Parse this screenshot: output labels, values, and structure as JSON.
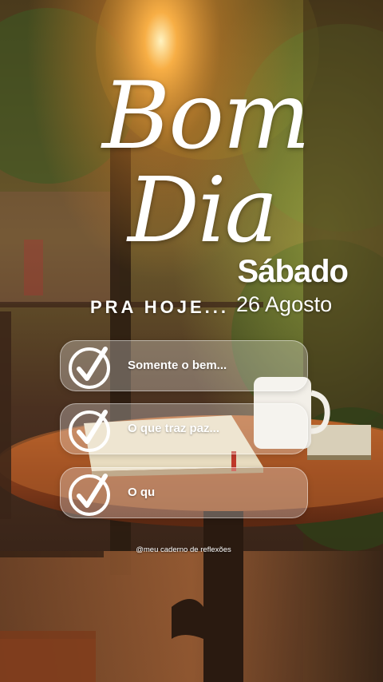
{
  "greeting": {
    "line1": "Bom",
    "line2": "Dia"
  },
  "weekday": "Sábado",
  "pra_hoje": "PRA HOJE...",
  "date": "26 Agosto",
  "items": [
    {
      "label": "Somente o bem..."
    },
    {
      "label": "O que traz paz..."
    },
    {
      "label": "O qu"
    }
  ],
  "watermark": "@meu caderno de reflexões",
  "colors": {
    "text": "#ffffff",
    "card_fill": "rgba(255,255,255,0.28)",
    "warm_light": "#ffb347",
    "wood": "#a0522d"
  },
  "icons": {
    "item_marker": "check-circle-icon"
  }
}
